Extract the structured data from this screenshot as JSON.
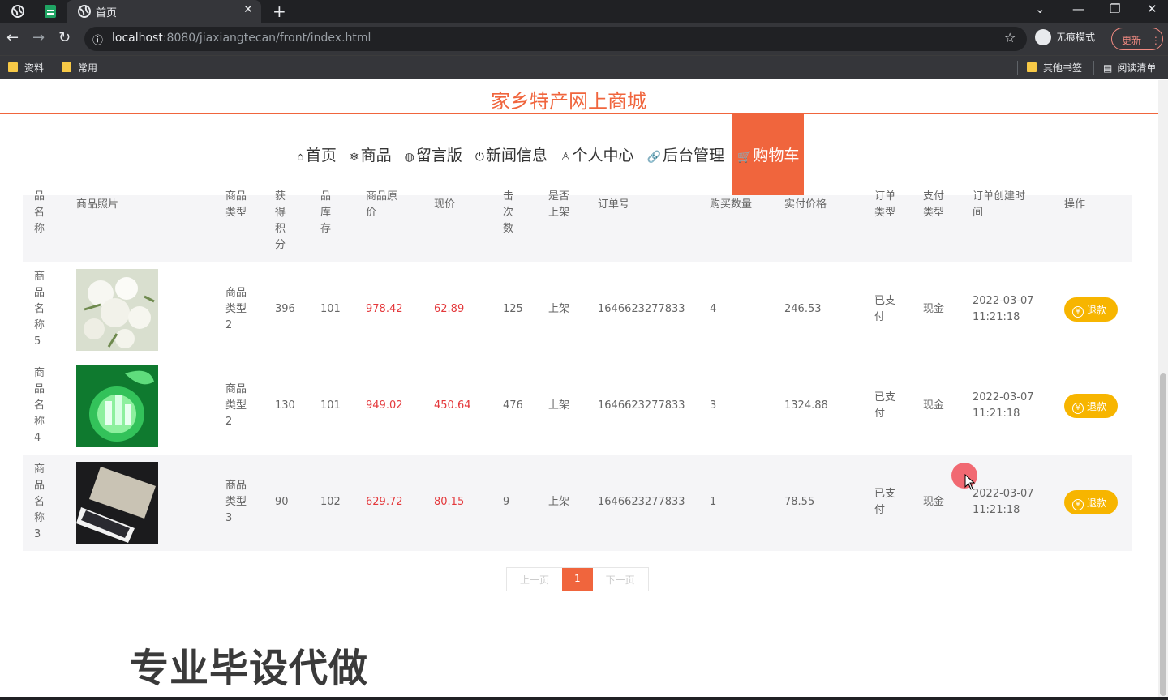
{
  "browser": {
    "tab_title": "首页",
    "url_host": "localhost",
    "url_rest": ":8080/jiaxiangtecan/front/index.html",
    "incognito_label": "无痕模式",
    "update_label": "更新",
    "bookmarks": [
      "资料",
      "常用"
    ],
    "other_bookmarks": "其他书签",
    "reading_list": "阅读清单"
  },
  "site": {
    "title": "家乡特产网上商城",
    "nav": [
      {
        "icon": "⌂",
        "label": "首页"
      },
      {
        "icon": "❄",
        "label": "商品"
      },
      {
        "icon": "◍",
        "label": "留言版"
      },
      {
        "icon": "⏻",
        "label": "新闻信息"
      },
      {
        "icon": "♙",
        "label": "个人中心"
      },
      {
        "icon": "🔗",
        "label": "后台管理"
      },
      {
        "icon": "🛒",
        "label": "购物车"
      }
    ]
  },
  "table": {
    "headers": {
      "name": "品\n名\n称",
      "photo": "商品照片",
      "type": "商品\n类型",
      "points": "获\n得\n积\n分",
      "stock": "品\n库\n存",
      "orig_price": "商品原\n价",
      "price": "现价",
      "clicks": "击\n次\n数",
      "listed": "是否\n上架",
      "order_no": "订单号",
      "qty": "购买数量",
      "paid": "实付价格",
      "order_type": "订单\n类型",
      "pay_type": "支付\n类型",
      "created": "订单创建时\n间",
      "op": "操作"
    },
    "rows": [
      {
        "name": "商\n品\n名\n称\n5",
        "type": "商品\n类型\n2",
        "points": "396",
        "stock": "101",
        "orig_price": "978.42",
        "price": "62.89",
        "clicks": "125",
        "listed": "上架",
        "order_no": "1646623277833",
        "qty": "4",
        "paid": "246.53",
        "order_type": "已支\n付",
        "pay_type": "现金",
        "created": "2022-03-07\n11:21:18",
        "action": "退款"
      },
      {
        "name": "商\n品\n名\n称\n4",
        "type": "商品\n类型\n2",
        "points": "130",
        "stock": "101",
        "orig_price": "949.02",
        "price": "450.64",
        "clicks": "476",
        "listed": "上架",
        "order_no": "1646623277833",
        "qty": "3",
        "paid": "1324.88",
        "order_type": "已支\n付",
        "pay_type": "现金",
        "created": "2022-03-07\n11:21:18",
        "action": "退款"
      },
      {
        "name": "商\n品\n名\n称\n3",
        "type": "商品\n类型\n3",
        "points": "90",
        "stock": "102",
        "orig_price": "629.72",
        "price": "80.15",
        "clicks": "9",
        "listed": "上架",
        "order_no": "1646623277833",
        "qty": "1",
        "paid": "78.55",
        "order_type": "已支\n付",
        "pay_type": "现金",
        "created": "2022-03-07\n11:21:18",
        "action": "退款"
      }
    ]
  },
  "pager": {
    "prev": "上一页",
    "current": "1",
    "next": "下一页"
  },
  "watermark": "专业毕设代做",
  "colors": {
    "accent": "#f0653d",
    "price": "#e4393c",
    "refund": "#f7b500"
  }
}
